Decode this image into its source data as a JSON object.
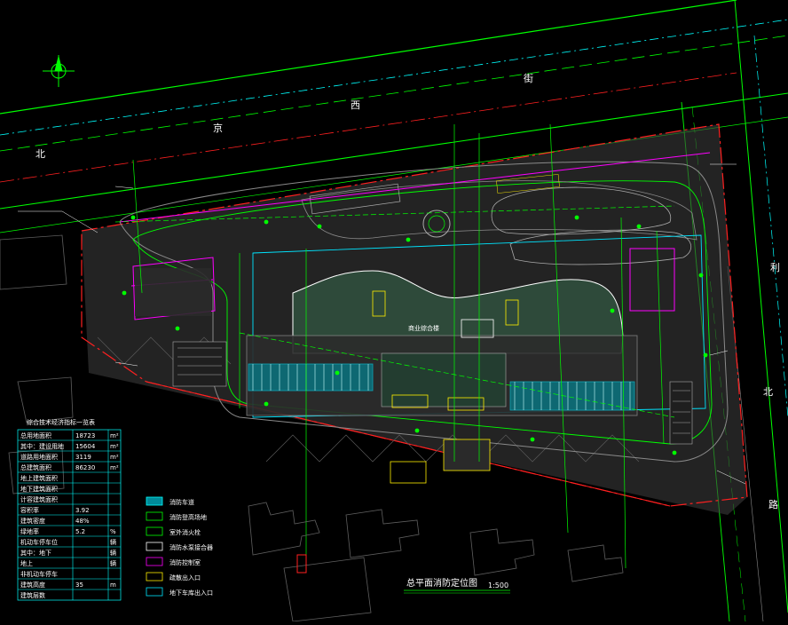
{
  "colors": {
    "background": "#000000",
    "roadline_green": "#00ff00",
    "boundary_red": "#ff2020",
    "accent_cyan": "#00e5ff",
    "accent_magenta": "#ff00ff",
    "accent_yellow": "#ffee00",
    "neutral_gray": "#8a8a8a",
    "building_fill": "#2e4a3a"
  },
  "streets": {
    "north_chars": [
      "北",
      "京",
      "西",
      "街"
    ],
    "east_chars": [
      "利",
      "北",
      "路"
    ]
  },
  "drawing": {
    "title": "总平面消防定位图",
    "scale": "1:500"
  },
  "table": {
    "title": "综合技术经济指标一览表",
    "rows": [
      {
        "name": "总用地面积",
        "value": "18723",
        "unit": "m²"
      },
      {
        "name": "其中：建设用地",
        "value": "15604",
        "unit": "m²"
      },
      {
        "name": "道路用地面积",
        "value": "3119",
        "unit": "m²"
      },
      {
        "name": "总建筑面积",
        "value": "86230",
        "unit": "m²"
      },
      {
        "name": "地上建筑面积",
        "value": "",
        "unit": ""
      },
      {
        "name": "地下建筑面积",
        "value": "",
        "unit": ""
      },
      {
        "name": "计容建筑面积",
        "value": "",
        "unit": ""
      },
      {
        "name": "容积率",
        "value": "3.92",
        "unit": ""
      },
      {
        "name": "建筑密度",
        "value": "48%",
        "unit": ""
      },
      {
        "name": "绿地率",
        "value": "5.2",
        "unit": "%"
      },
      {
        "name": "机动车停车位",
        "value": "",
        "unit": "辆"
      },
      {
        "name": "其中：地下",
        "value": "",
        "unit": "辆"
      },
      {
        "name": "地上",
        "value": "",
        "unit": "辆"
      },
      {
        "name": "非机动车停车",
        "value": "",
        "unit": ""
      },
      {
        "name": "建筑高度",
        "value": "35",
        "unit": "m"
      },
      {
        "name": "建筑层数",
        "value": "",
        "unit": ""
      }
    ]
  },
  "legend": {
    "items": [
      {
        "label": "消防车道"
      },
      {
        "label": "消防登高场地"
      },
      {
        "label": "室外消火栓"
      },
      {
        "label": "消防水泵接合器"
      },
      {
        "label": "消防控制室"
      },
      {
        "label": "疏散出入口"
      },
      {
        "label": "地下车库出入口"
      }
    ]
  },
  "site": {
    "main_building_label": "商业综合楼"
  }
}
